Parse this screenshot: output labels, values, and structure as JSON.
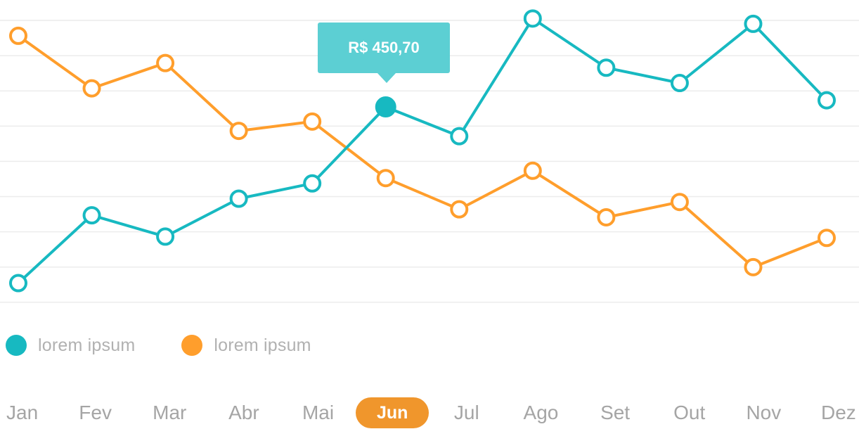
{
  "chart_data": {
    "type": "line",
    "categories": [
      "Jan",
      "Fev",
      "Mar",
      "Abr",
      "Mai",
      "Jun",
      "Jul",
      "Ago",
      "Set",
      "Out",
      "Nov",
      "Dez"
    ],
    "series": [
      {
        "name": "lorem ipsum",
        "color": "#17b9c1",
        "values": [
          10,
          112,
          80,
          137,
          160,
          275,
          231,
          408,
          334,
          311,
          400,
          285
        ]
      },
      {
        "name": "lorem ipsum",
        "color": "#ff9e2c",
        "values": [
          382,
          303,
          341,
          239,
          253,
          168,
          121,
          179,
          109,
          132,
          34,
          78
        ]
      }
    ],
    "ylim": [
      0,
      420
    ],
    "grid": true,
    "legend_position": "bottom-left",
    "selected_category": "Jun",
    "tooltip": {
      "series_index": 0,
      "category": "Jun",
      "text": "R$ 450,70"
    }
  }
}
